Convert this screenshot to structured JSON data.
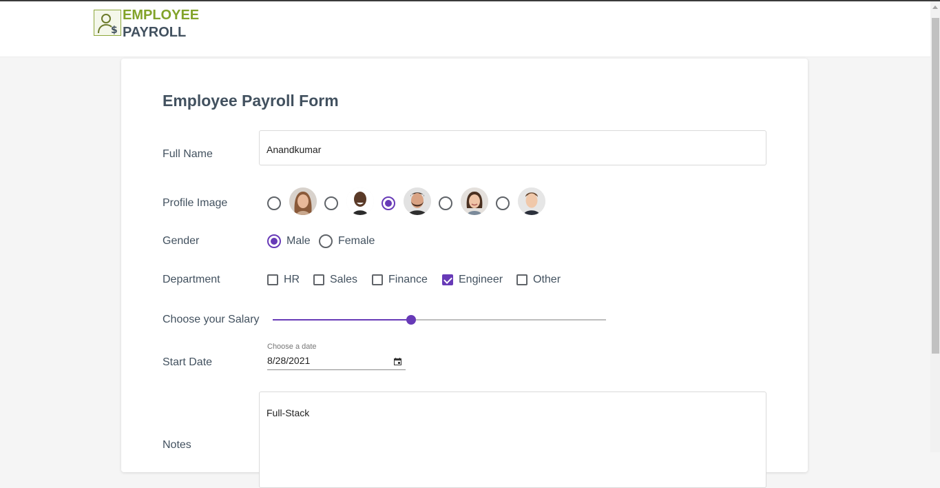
{
  "header": {
    "logo_line1": "EMPLOYEE",
    "logo_line2": "PAYROLL",
    "logo_icon": "user-dollar-icon"
  },
  "form": {
    "title": "Employee Payroll Form",
    "full_name": {
      "label": "Full Name",
      "value": "Anandkumar"
    },
    "profile_image": {
      "label": "Profile Image",
      "options": [
        {
          "name": "profile-woman-1",
          "selected": false
        },
        {
          "name": "profile-man-1",
          "selected": false
        },
        {
          "name": "profile-man-2",
          "selected": true
        },
        {
          "name": "profile-woman-2",
          "selected": false
        },
        {
          "name": "profile-man-3",
          "selected": false
        }
      ]
    },
    "gender": {
      "label": "Gender",
      "options": [
        {
          "label": "Male",
          "selected": true
        },
        {
          "label": "Female",
          "selected": false
        }
      ]
    },
    "department": {
      "label": "Department",
      "options": [
        {
          "label": "HR",
          "checked": false
        },
        {
          "label": "Sales",
          "checked": false
        },
        {
          "label": "Finance",
          "checked": false
        },
        {
          "label": "Engineer",
          "checked": true
        },
        {
          "label": "Other",
          "checked": false
        }
      ]
    },
    "salary": {
      "label": "Choose your Salary",
      "fraction": 0.415
    },
    "start_date": {
      "label": "Start Date",
      "caption": "Choose a date",
      "value": "8/28/2021"
    },
    "notes": {
      "label": "Notes",
      "value": "Full-Stack"
    }
  },
  "colors": {
    "accent": "#673ab7",
    "brand_green": "#82a32a",
    "text": "#42515f"
  }
}
